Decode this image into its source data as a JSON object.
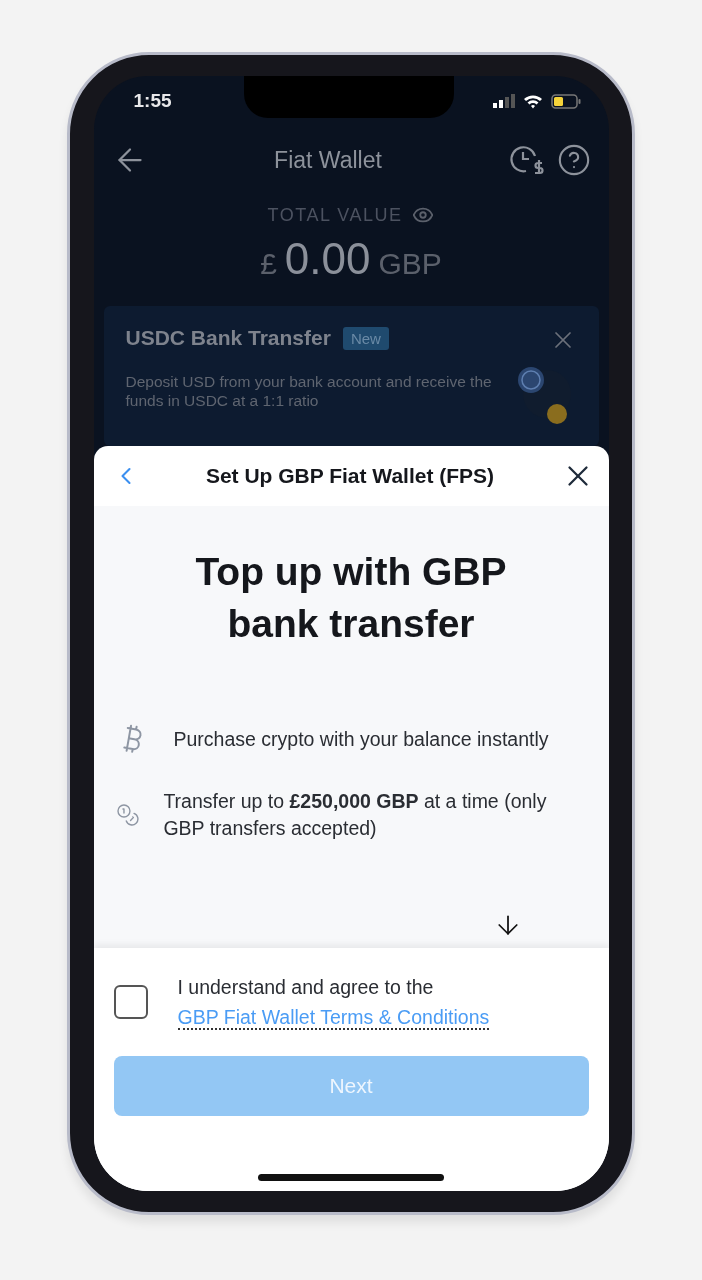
{
  "status_bar": {
    "time": "1:55"
  },
  "header": {
    "title": "Fiat Wallet"
  },
  "total": {
    "label": "TOTAL VALUE",
    "currency_symbol": "£",
    "amount": "0.00",
    "currency": "GBP"
  },
  "banner": {
    "title": "USDC Bank Transfer",
    "badge": "New",
    "text": "Deposit USD from your bank account and receive the funds in USDC at a 1:1 ratio"
  },
  "sheet": {
    "title": "Set Up GBP Fiat Wallet (FPS)",
    "heading": "Top up with GBP bank transfer",
    "features": [
      {
        "kind": "bitcoin",
        "text": "Purchase crypto with your balance instantly"
      },
      {
        "kind": "coins",
        "text": "Transfer up to **£250,000 GBP** at a time (only GBP transfers accepted)"
      }
    ],
    "agreement": {
      "checked": false,
      "text": "I understand and agree to the",
      "link": "GBP Fiat Wallet Terms & Conditions"
    },
    "button": {
      "label": "Next",
      "disabled": true
    }
  }
}
